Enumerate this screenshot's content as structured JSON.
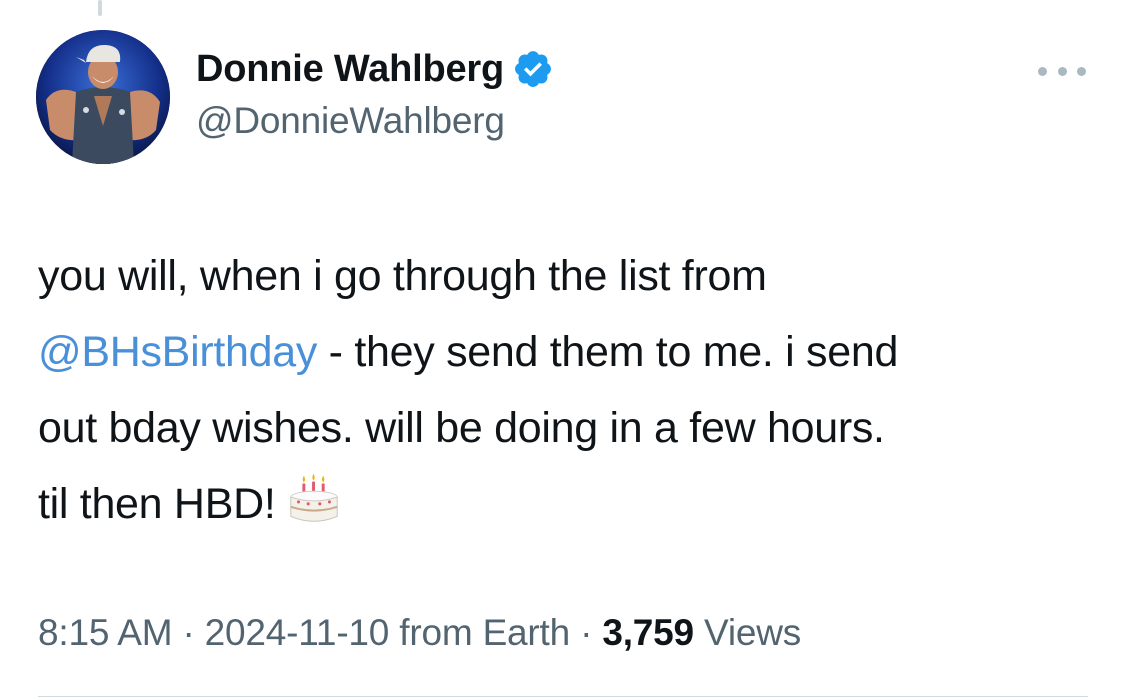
{
  "author": {
    "display_name": "Donnie Wahlberg",
    "handle": "@DonnieWahlberg",
    "verified": true
  },
  "tweet": {
    "line1": "you will, when i go through the list from",
    "mention": "@BHsBirthday",
    "line2_rest": " - they send them to me. i send",
    "line3": "out bday wishes. will be doing in a few hours.",
    "line4": "til then HBD!",
    "emoji": "birthday-cake"
  },
  "meta": {
    "time": "8:15 AM",
    "separator": "·",
    "date": "2024-11-10",
    "source": "from Earth",
    "views_count": "3,759",
    "views_label": "Views"
  },
  "colors": {
    "link": "#4a90d9",
    "verified_badge": "#1d9bf0",
    "secondary_text": "#536471"
  },
  "icons": [
    "verified-badge-icon",
    "more-options-icon",
    "birthday-cake-emoji"
  ]
}
